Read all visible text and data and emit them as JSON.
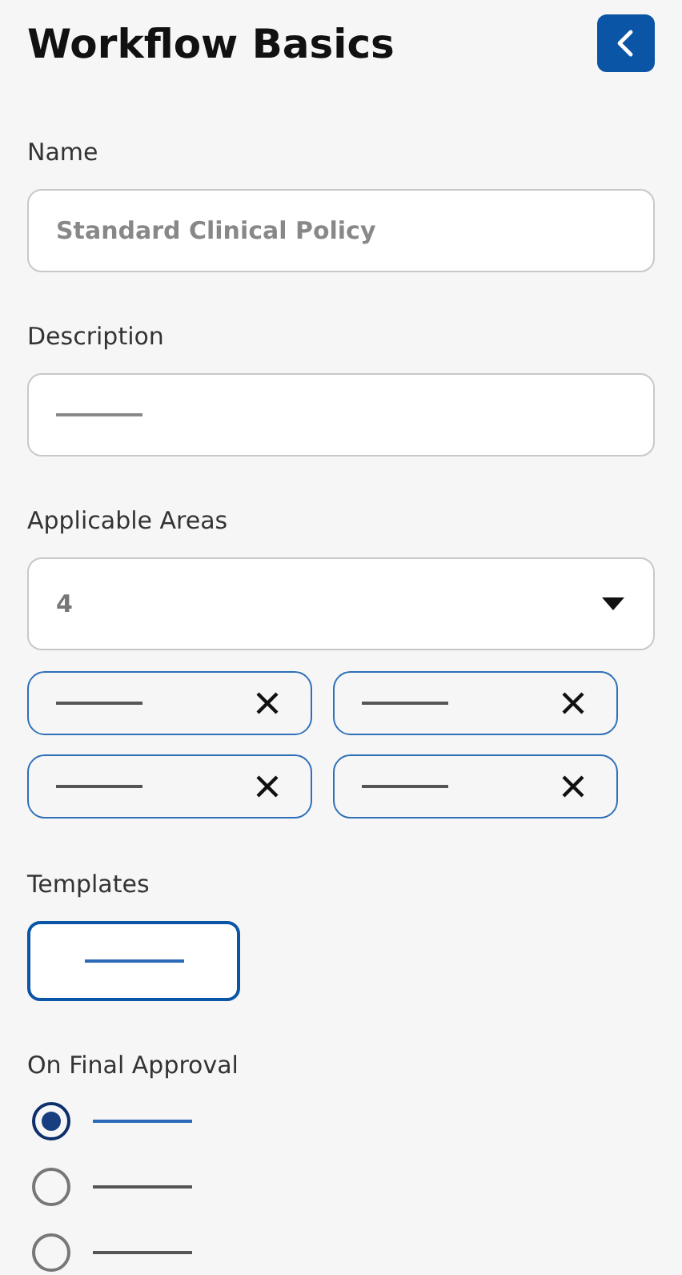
{
  "title": "Workflow Basics",
  "name_field": {
    "label": "Name",
    "placeholder": "Standard Clinical Policy"
  },
  "description_field": {
    "label": "Description"
  },
  "applicable_areas": {
    "label": "Applicable Areas",
    "value": "4",
    "chips": [
      {
        "kind": "chip"
      },
      {
        "kind": "chip"
      },
      {
        "kind": "chip"
      },
      {
        "kind": "chip"
      }
    ]
  },
  "templates": {
    "label": "Templates"
  },
  "final_approval": {
    "label": "On Final Approval",
    "options": [
      {
        "selected": true
      },
      {
        "selected": false
      },
      {
        "selected": false
      }
    ]
  }
}
